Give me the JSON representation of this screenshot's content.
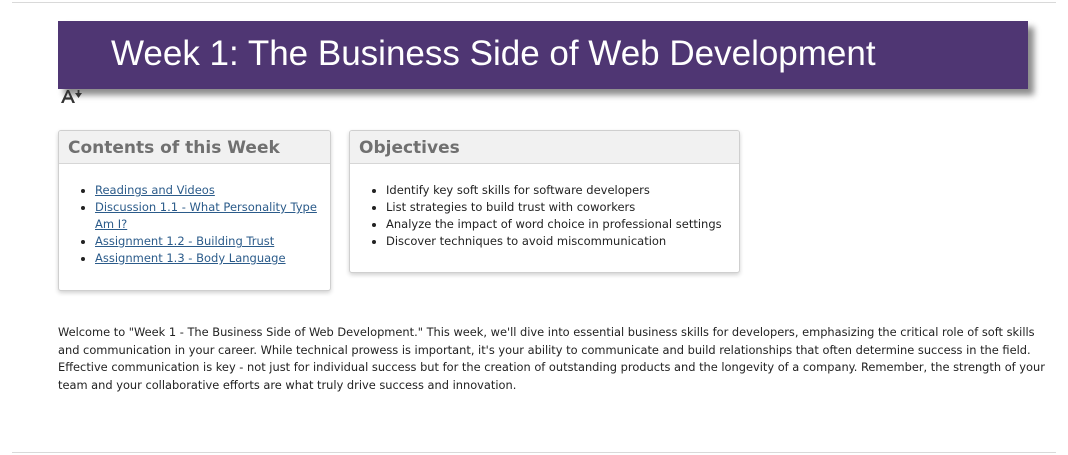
{
  "page": {
    "banner_title": "Week 1: The Business Side of Web Development",
    "accessibility_icon_name": "accessibility-text-size-icon"
  },
  "contents": {
    "heading": "Contents of this Week",
    "items": [
      {
        "label": "Readings and Videos"
      },
      {
        "label": "Discussion 1.1 - What Personality Type Am I?"
      },
      {
        "label": "Assignment 1.2 - Building Trust"
      },
      {
        "label": "Assignment 1.3 - Body Language"
      }
    ]
  },
  "objectives": {
    "heading": "Objectives",
    "items": [
      {
        "label": "Identify key soft skills for software developers"
      },
      {
        "label": "List strategies to build trust with coworkers"
      },
      {
        "label": "Analyze the impact of word choice in professional settings"
      },
      {
        "label": "Discover techniques to avoid miscommunication"
      }
    ]
  },
  "intro": {
    "text": "Welcome to \"Week 1 - The Business Side of Web Development.\"  This week, we'll dive into essential business skills for developers, emphasizing the critical role of soft skills and communication in your career.  While technical prowess is important, it's your ability to communicate and build relationships that often determine success in the field.\n Effective communication is key - not just for individual success but for the creation of outstanding products and the longevity of a company.  Remember, the strength of your team and your collaborative efforts are what truly drive success and innovation."
  },
  "colors": {
    "banner_bg": "#4f3673",
    "banner_text": "#ffffff",
    "link": "#2b5b8a",
    "card_heading": "#707070",
    "card_header_bg": "#f1f1f1"
  }
}
